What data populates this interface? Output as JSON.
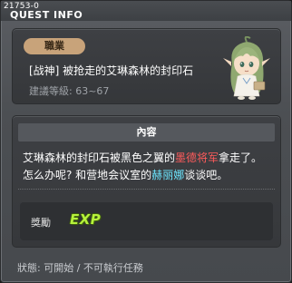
{
  "window": {
    "id_label": "21753-0",
    "title": "QUEST INFO"
  },
  "quest": {
    "type_tag": "職業",
    "name": "[战神] 被抢走的艾琳森林的封印石",
    "recommended_level": "建議等級: 63~67"
  },
  "content": {
    "header": "內容",
    "line1_part1": "艾琳森林的封印石被黑色之翼的",
    "line1_highlight": "墨德将军",
    "line1_part2": "拿走了。",
    "line2_part1": "怎么办呢? 和营地会议室的",
    "line2_highlight": "赫丽娜",
    "line2_part2": "谈谈吧。"
  },
  "reward": {
    "label": "獎勵",
    "exp_text": "EXP"
  },
  "status": {
    "text": "狀態: 可開始 / 不可執行任務"
  },
  "colors": {
    "tag_bg": "#c8a37a",
    "highlight_red": "#ff5b5b",
    "highlight_cyan": "#6de7ff",
    "exp_green": "#b6f23b"
  },
  "icons": [
    "npc-portrait-icon",
    "exp-reward-icon"
  ]
}
